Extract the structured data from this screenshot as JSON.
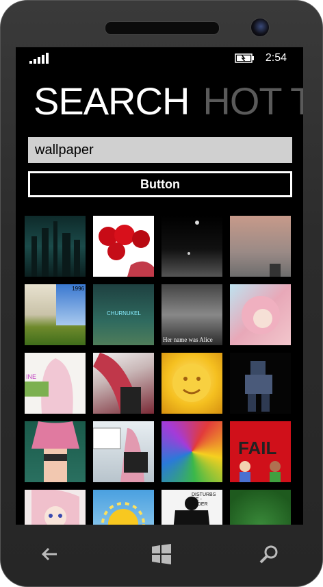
{
  "status": {
    "time": "2:54"
  },
  "pivot": {
    "active": "SEARCH",
    "next": "HOT TO"
  },
  "search": {
    "value": "wallpaper"
  },
  "button": {
    "label": "Button"
  },
  "tiles": {
    "t1": {
      "label": "",
      "desc": "dark city"
    },
    "t6": {
      "label": "1996"
    },
    "t8": {
      "label": "Her name was Alice"
    },
    "t9": {
      "label": "INE"
    },
    "t15": {
      "label": "FAIL"
    },
    "t17": {
      "label": "DISTURBS ME - VADER"
    }
  },
  "nav": {
    "back": "back-icon",
    "start": "windows-icon",
    "search": "search-icon"
  }
}
